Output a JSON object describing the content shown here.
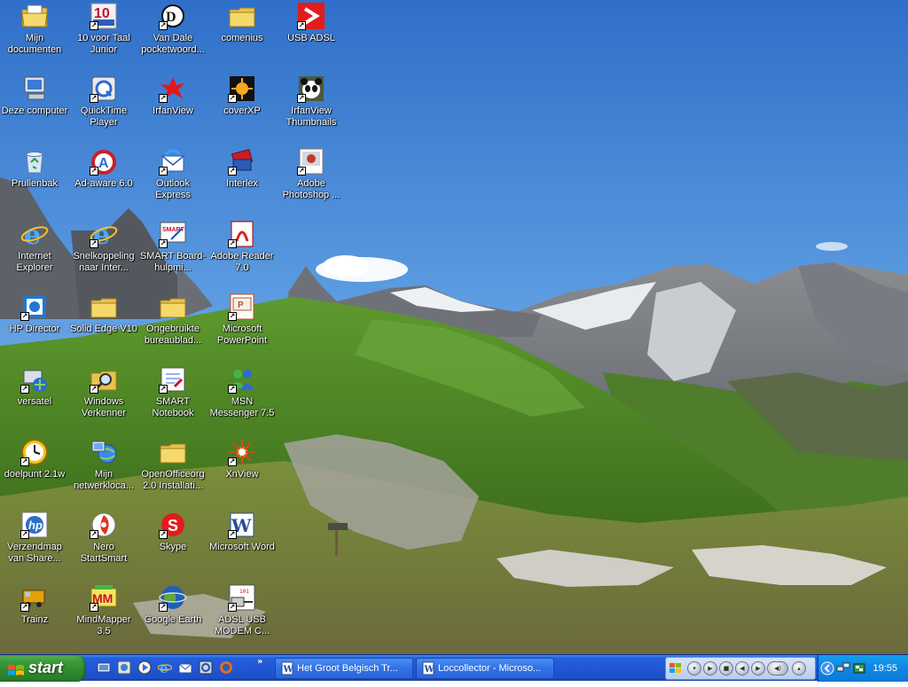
{
  "desktop": {
    "icons": [
      {
        "id": "mijn-documenten",
        "label": "Mijn documenten",
        "type": "folder-docs",
        "shortcut": false
      },
      {
        "id": "10-voor-taal",
        "label": "10 voor Taal Junior",
        "type": "app-10",
        "shortcut": true
      },
      {
        "id": "van-dale",
        "label": "Van Dale pocketwoord...",
        "type": "app-vandale",
        "shortcut": true
      },
      {
        "id": "comenius",
        "label": "comenius",
        "type": "folder",
        "shortcut": false
      },
      {
        "id": "usb-adsl",
        "label": "USB ADSL",
        "type": "app-usbadsl",
        "shortcut": true
      },
      {
        "id": "deze-computer",
        "label": "Deze computer",
        "type": "computer",
        "shortcut": false
      },
      {
        "id": "quicktime",
        "label": "QuickTime Player",
        "type": "app-quicktime",
        "shortcut": true
      },
      {
        "id": "irfanview",
        "label": "IrfanView",
        "type": "app-irfan",
        "shortcut": true
      },
      {
        "id": "coverxp",
        "label": "coverXP",
        "type": "app-coverxp",
        "shortcut": true
      },
      {
        "id": "irfanview-thumbs",
        "label": "IrfanView Thumbnails",
        "type": "app-panda",
        "shortcut": true
      },
      {
        "id": "prullenbak",
        "label": "Prullenbak",
        "type": "recycle",
        "shortcut": false
      },
      {
        "id": "ad-aware",
        "label": "Ad-aware 6.0",
        "type": "app-adaware",
        "shortcut": true
      },
      {
        "id": "outlook-express",
        "label": "Outlook Express",
        "type": "app-outlook",
        "shortcut": true
      },
      {
        "id": "interlex",
        "label": "Interlex",
        "type": "app-interlex",
        "shortcut": true
      },
      {
        "id": "photoshop",
        "label": "Adobe Photoshop ...",
        "type": "app-photoshop",
        "shortcut": true
      },
      {
        "id": "internet-explorer",
        "label": "Internet Explorer",
        "type": "app-ie",
        "shortcut": false
      },
      {
        "id": "snelkoppeling-ie",
        "label": "Snelkoppeling naar Inter...",
        "type": "app-ie",
        "shortcut": true
      },
      {
        "id": "smart-board",
        "label": "SMART Board-hulpmi...",
        "type": "app-smart",
        "shortcut": true
      },
      {
        "id": "adobe-reader",
        "label": "Adobe Reader 7.0",
        "type": "app-reader",
        "shortcut": true
      },
      {
        "id": "hp-director",
        "label": "HP Director",
        "type": "app-hpdirector",
        "shortcut": true
      },
      {
        "id": "solid-edge",
        "label": "Solid Edge V10",
        "type": "folder",
        "shortcut": false
      },
      {
        "id": "ongebruikte",
        "label": "Ongebruikte bureaublad...",
        "type": "folder",
        "shortcut": false
      },
      {
        "id": "powerpoint",
        "label": "Microsoft PowerPoint",
        "type": "app-powerpoint",
        "shortcut": true
      },
      {
        "id": "versatel",
        "label": "versatel",
        "type": "app-versatel",
        "shortcut": true
      },
      {
        "id": "windows-verkenner",
        "label": "Windows Verkenner",
        "type": "app-explorer",
        "shortcut": true
      },
      {
        "id": "smart-notebook",
        "label": "SMART Notebook",
        "type": "app-notebook",
        "shortcut": true
      },
      {
        "id": "msn-messenger",
        "label": "MSN Messenger 7.5",
        "type": "app-msn",
        "shortcut": true
      },
      {
        "id": "doelpunt",
        "label": "doelpunt 2.1w",
        "type": "app-clock",
        "shortcut": true
      },
      {
        "id": "mijn-netwerk",
        "label": "Mijn netwerkloca...",
        "type": "network",
        "shortcut": false
      },
      {
        "id": "openoffice",
        "label": "OpenOfficeorg 2.0 Installati...",
        "type": "folder",
        "shortcut": false
      },
      {
        "id": "xnview",
        "label": "XnView",
        "type": "app-xnview",
        "shortcut": true
      },
      {
        "id": "verzendmap",
        "label": "Verzendmap van Share...",
        "type": "app-hp",
        "shortcut": true
      },
      {
        "id": "nero",
        "label": "Nero StartSmart",
        "type": "app-nero",
        "shortcut": true
      },
      {
        "id": "skype",
        "label": "Skype",
        "type": "app-skype",
        "shortcut": true
      },
      {
        "id": "microsoft-word",
        "label": "Microsoft Word",
        "type": "app-word",
        "shortcut": true
      },
      {
        "id": "trainz",
        "label": "Trainz",
        "type": "app-trainz",
        "shortcut": true
      },
      {
        "id": "mindmapper",
        "label": "MindMapper 3.5",
        "type": "app-mindmapper",
        "shortcut": true
      },
      {
        "id": "google-earth",
        "label": "Google Earth",
        "type": "app-earth",
        "shortcut": true
      },
      {
        "id": "adsl-usb-modem",
        "label": "ADSL USB MODEM C...",
        "type": "app-modem",
        "shortcut": true
      }
    ]
  },
  "taskbar": {
    "start_label": "start",
    "tasks": [
      {
        "label": "Het Groot Belgisch Tr...",
        "icon": "word-doc-icon"
      },
      {
        "label": "Loccollector - Microso...",
        "icon": "word-doc-icon"
      }
    ],
    "more_label": "»",
    "clock": "19:55"
  },
  "colors": {
    "taskbar_blue": "#245edb",
    "start_green": "#3c9e3c",
    "tray_blue": "#0f8ae4"
  }
}
